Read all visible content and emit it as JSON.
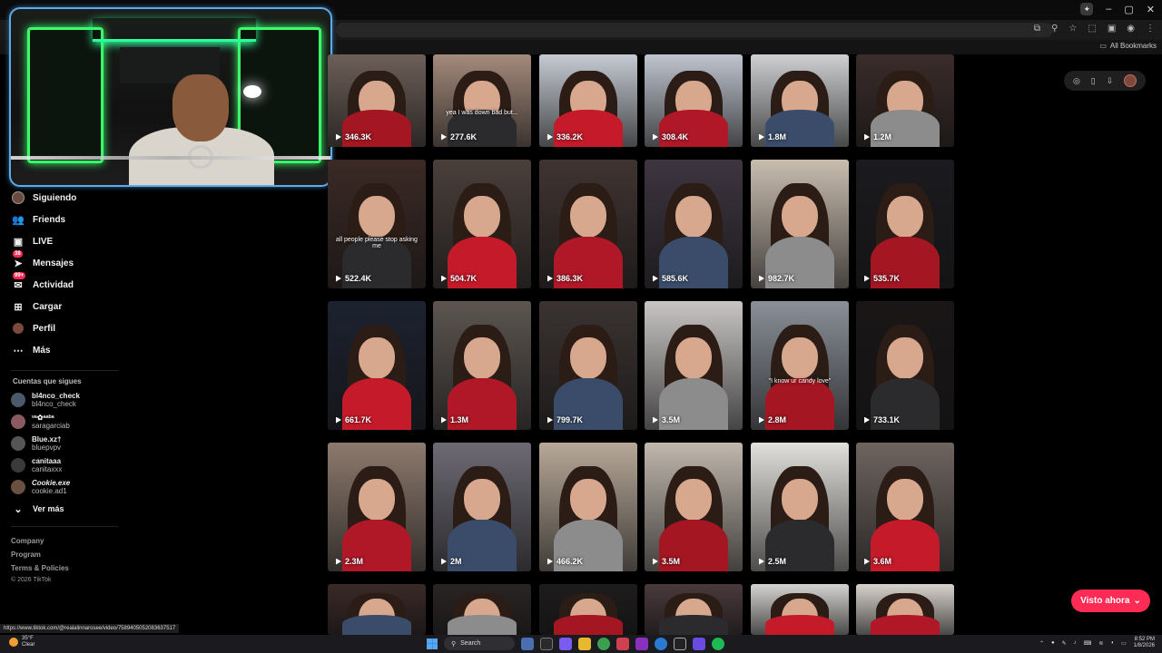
{
  "browser": {
    "bookmarks_label": "All Bookmarks",
    "window_controls": [
      "–",
      "▢",
      "✕"
    ],
    "status_url": "https://www.tiktok.com/@realalinnarosee/video/7589405052083637517"
  },
  "sidebar": {
    "nav": [
      {
        "label": "Siguiendo",
        "icon": "following-avatar-icon"
      },
      {
        "label": "Friends",
        "icon": "friends-icon"
      },
      {
        "label": "LIVE",
        "icon": "live-icon"
      },
      {
        "label": "Mensajes",
        "icon": "messages-icon",
        "badge": "38"
      },
      {
        "label": "Actividad",
        "icon": "activity-icon",
        "badge": "99+"
      },
      {
        "label": "Cargar",
        "icon": "upload-icon"
      },
      {
        "label": "Perfil",
        "icon": "profile-icon"
      },
      {
        "label": "Más",
        "icon": "more-icon"
      }
    ],
    "following_title": "Cuentas que sigues",
    "following": [
      {
        "name": "bl4nco_check",
        "handle": "bl4nco_check"
      },
      {
        "name": "ᵛᵃ✿ᵃᵃᵇᵃ",
        "handle": "saragarciab"
      },
      {
        "name": "Blue.xz†",
        "handle": "bluepvpv"
      },
      {
        "name": "canitaaa",
        "handle": "canitaxxx"
      },
      {
        "name": "Cookie.exe",
        "handle": "cookie.ad1"
      }
    ],
    "see_more": "Ver más",
    "footer": [
      "Company",
      "Program",
      "Terms & Policies",
      "© 2026 TikTok"
    ]
  },
  "grid": {
    "rows": [
      [
        "346.3K",
        "277.6K",
        "336.2K",
        "308.4K",
        "1.8M",
        "1.2M"
      ],
      [
        "522.4K",
        "504.7K",
        "386.3K",
        "585.6K",
        "982.7K",
        "535.7K"
      ],
      [
        "661.7K",
        "1.3M",
        "799.7K",
        "3.5M",
        "2.8M",
        "733.1K"
      ],
      [
        "2.3M",
        "2M",
        "466.2K",
        "3.5M",
        "2.5M",
        "3.6M"
      ],
      [
        "",
        "",
        "",
        "",
        "",
        ""
      ]
    ],
    "captions": {
      "r0c1": "yea I was down bad but...",
      "r1c0": "all people please stop asking me",
      "r2c4": "\"I know ur candy love\""
    }
  },
  "watched_button": "Visto ahora",
  "taskbar": {
    "weather_temp": "35°F",
    "weather_desc": "Clear",
    "search_placeholder": "Search",
    "time": "8:52 PM",
    "date": "1/8/2026"
  },
  "colors": {
    "accent": "#fe2c55",
    "background": "#000000",
    "cam_border": "#5fa9e6",
    "neon": "#3bff6a"
  }
}
